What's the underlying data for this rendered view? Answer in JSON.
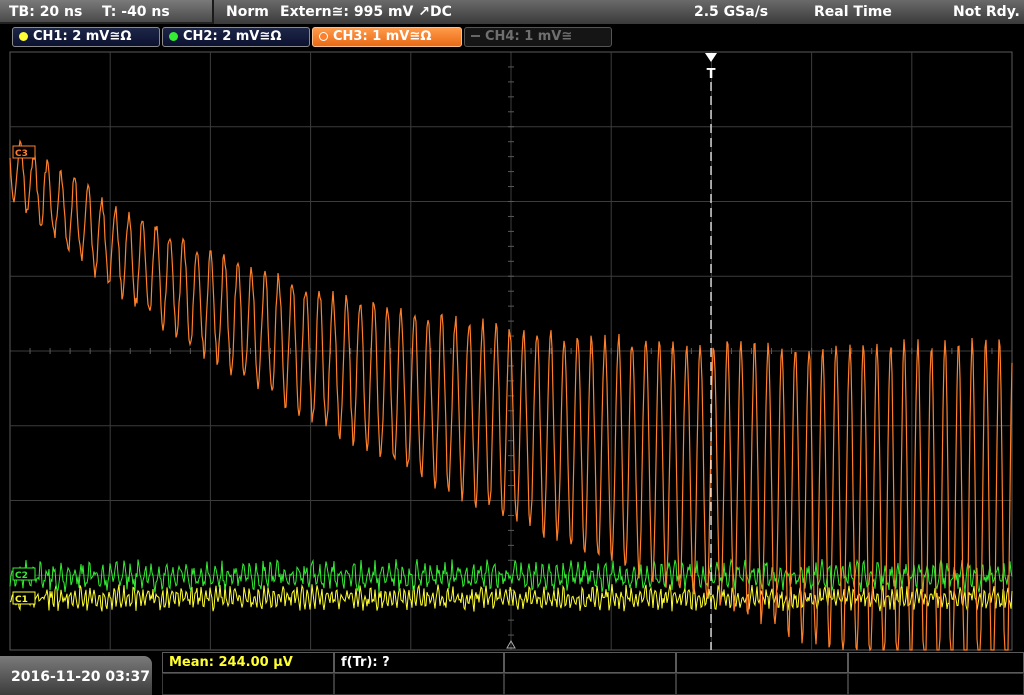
{
  "status": {
    "timebase": "TB: 20 ns",
    "trigger_offset": "T: -40 ns",
    "mode": "Norm",
    "trigger": "Extern≅: 995 mV ↗DC",
    "sample_rate": "2.5 GSa/s",
    "acquisition": "Real Time",
    "state": "Not Rdy."
  },
  "channels": [
    {
      "label": "CH1: 2 mV≅Ω",
      "color": "#ffff33",
      "state": "on"
    },
    {
      "label": "CH2: 2 mV≅Ω",
      "color": "#33ee33",
      "state": "on"
    },
    {
      "label": "CH3: 1 mV≅Ω",
      "color": "#ff7f2a",
      "state": "selected"
    },
    {
      "label": "CH4: 1 mV≅",
      "color": "#666666",
      "state": "off"
    }
  ],
  "markers": {
    "ch3": "C3",
    "ch2": "C2",
    "ch1": "C1",
    "trigger": "T"
  },
  "measurements": {
    "mean": "Mean: 244.00 µV",
    "freq": "f(Tr): ?"
  },
  "datetime": "2016-11-20 03:37",
  "colors": {
    "ch1": "#ffff33",
    "ch2": "#33ee33",
    "ch3": "#ff7f2a",
    "grid": "#4a4a4a"
  }
}
